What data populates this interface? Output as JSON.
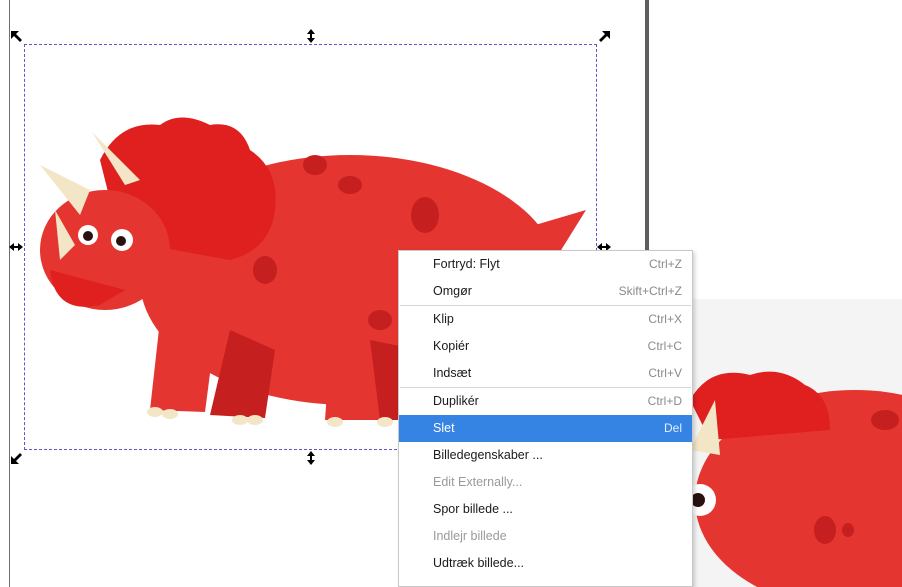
{
  "context_menu": {
    "items": [
      {
        "label": "Fortryd: Flyt",
        "shortcut": "Ctrl+Z"
      },
      {
        "label": "Omgør",
        "shortcut": "Skift+Ctrl+Z"
      },
      {
        "label": "Klip",
        "shortcut": "Ctrl+X"
      },
      {
        "label": "Kopiér",
        "shortcut": "Ctrl+C"
      },
      {
        "label": "Indsæt",
        "shortcut": "Ctrl+V"
      },
      {
        "label": "Duplikér",
        "shortcut": "Ctrl+D"
      },
      {
        "label": "Slet",
        "shortcut": "Del",
        "state": "highlighted"
      },
      {
        "label": "Billedegenskaber ...",
        "shortcut": ""
      },
      {
        "label": "Edit Externally...",
        "shortcut": "",
        "state": "disabled"
      },
      {
        "label": "Spor billede ...",
        "shortcut": ""
      },
      {
        "label": "Indlejr billede",
        "shortcut": "",
        "state": "disabled"
      },
      {
        "label": "Udtræk billede...",
        "shortcut": ""
      }
    ]
  },
  "colors": {
    "highlight": "#3584e4",
    "selection_border": "#5a5acc",
    "dino_red": "#e53530",
    "dino_dark": "#c61f1f",
    "horn": "#f3e6c6"
  },
  "icons": [
    "scale-handle-icon",
    "resize-vertical-icon",
    "resize-horizontal-icon"
  ]
}
